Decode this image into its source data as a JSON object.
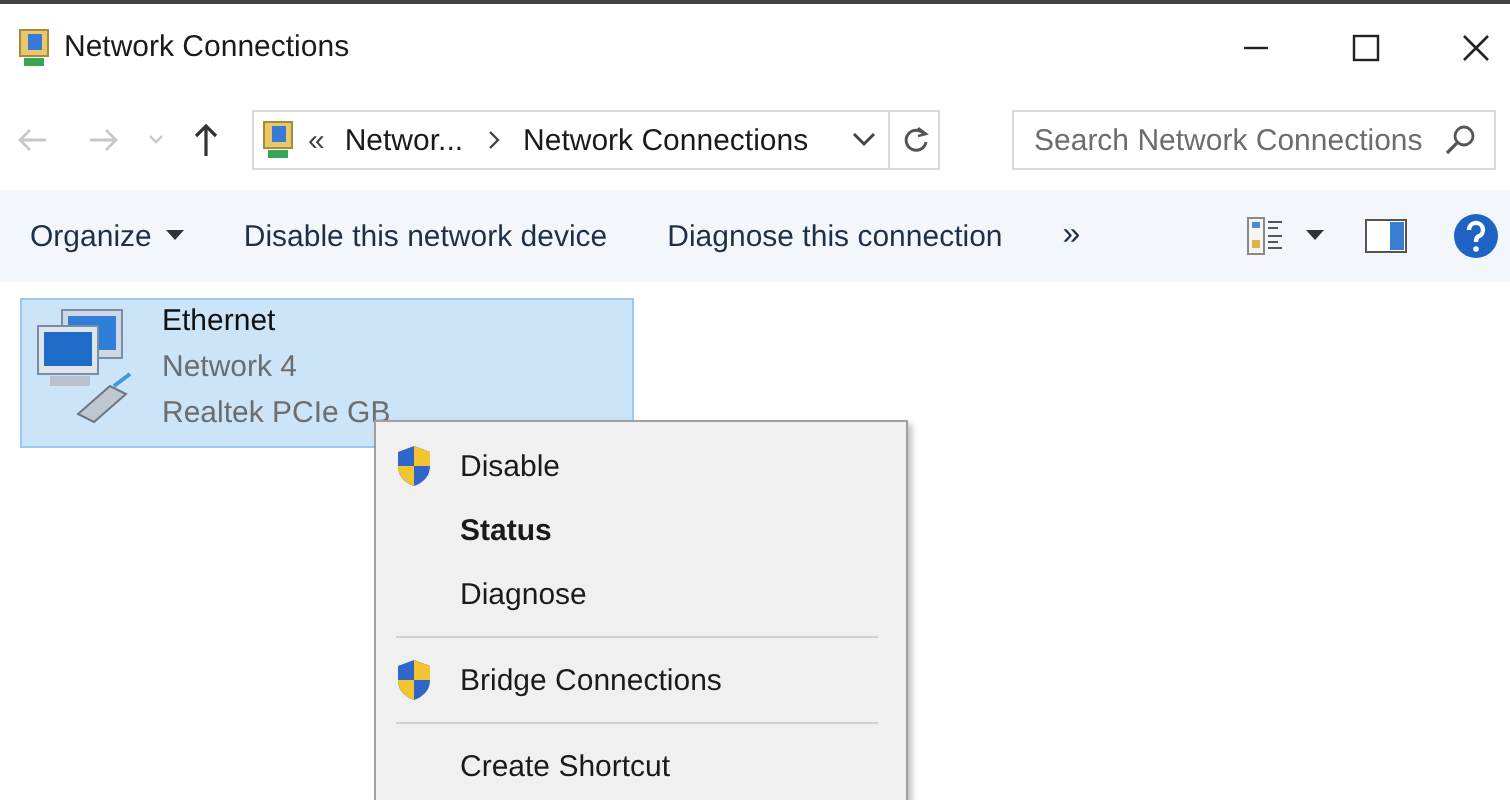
{
  "window": {
    "title": "Network Connections"
  },
  "navigation": {
    "buttons": [
      {
        "kind": "back",
        "disabled": true
      },
      {
        "kind": "forward",
        "disabled": true
      },
      {
        "kind": "recent",
        "disabled": true
      },
      {
        "kind": "up",
        "disabled": false
      }
    ]
  },
  "address_bar": {
    "overflow": "«",
    "crumbs": [
      "Networ...",
      "Network Connections"
    ]
  },
  "search": {
    "placeholder": "Search Network Connections"
  },
  "toolbar": {
    "items": [
      "Organize",
      "Disable this network device",
      "Diagnose this connection"
    ],
    "more": "»"
  },
  "connections": [
    {
      "name": "Ethernet",
      "network": "Network 4",
      "adapter": "Realtek PCIe GB",
      "selected": true
    }
  ],
  "context_menu": {
    "items": [
      {
        "kind": "item",
        "label": "Disable",
        "shield": true,
        "default": false
      },
      {
        "kind": "item",
        "label": "Status",
        "shield": false,
        "default": true
      },
      {
        "kind": "item",
        "label": "Diagnose",
        "shield": false,
        "default": false
      },
      {
        "kind": "separator"
      },
      {
        "kind": "item",
        "label": "Bridge Connections",
        "shield": true,
        "default": false
      },
      {
        "kind": "separator"
      },
      {
        "kind": "item",
        "label": "Create Shortcut",
        "shield": false,
        "default": false
      }
    ]
  }
}
